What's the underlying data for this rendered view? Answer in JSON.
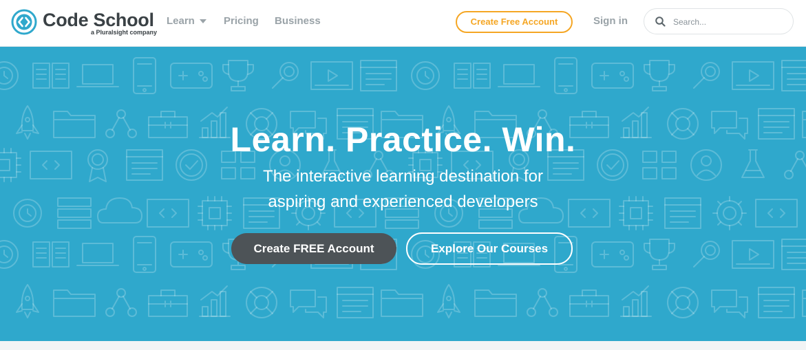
{
  "brand": {
    "name": "Code School",
    "tagline": "a Pluralsight company",
    "color": "#3a4145",
    "mark_color": "#2fa8cc"
  },
  "nav": {
    "items": [
      {
        "label": "Learn",
        "has_dropdown": true
      },
      {
        "label": "Pricing"
      },
      {
        "label": "Business"
      }
    ],
    "create_account_label": "Create Free Account",
    "sign_in_label": "Sign in",
    "accent_color": "#f5a623"
  },
  "search": {
    "placeholder": "Search...",
    "value": "",
    "icon": "search-icon"
  },
  "hero": {
    "title": "Learn. Practice. Win.",
    "subtitle_lines": [
      "The interactive learning destination for",
      "aspiring and experienced developers"
    ],
    "primary_button": "Create FREE Account",
    "secondary_button": "Explore Our Courses",
    "background_color": "#2fa8cc",
    "pattern_icons": [
      "clock",
      "book",
      "laptop",
      "phone",
      "gamepad",
      "trophy",
      "magnifier",
      "video",
      "browser",
      "rocket",
      "folder",
      "network",
      "toolbox",
      "chart",
      "lifebuoy",
      "chat",
      "code",
      "ribbon",
      "check",
      "grid",
      "user",
      "flask",
      "chip",
      "stack",
      "cloud",
      "gear"
    ]
  }
}
